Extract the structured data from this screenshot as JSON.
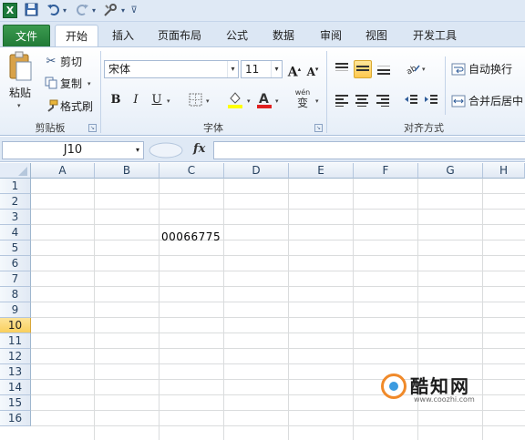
{
  "qat": {
    "save_icon": "save-icon",
    "undo_icon": "undo-icon",
    "redo_icon": "redo-icon",
    "tool_icon": "tools-icon",
    "customize_icon": "customize-icon",
    "logo_letter": "X"
  },
  "tabs": [
    {
      "label": "文件"
    },
    {
      "label": "开始"
    },
    {
      "label": "插入"
    },
    {
      "label": "页面布局"
    },
    {
      "label": "公式"
    },
    {
      "label": "数据"
    },
    {
      "label": "审阅"
    },
    {
      "label": "视图"
    },
    {
      "label": "开发工具"
    }
  ],
  "ribbon": {
    "clipboard": {
      "paste": "粘贴",
      "cut": "剪切",
      "copy": "复制",
      "format_painter": "格式刷",
      "label": "剪贴板"
    },
    "font": {
      "name": "宋体",
      "size": "11",
      "grow": "A",
      "shrink": "A",
      "bold": "B",
      "italic": "I",
      "underline": "U",
      "wen": "wén",
      "wen_char": "变",
      "label": "字体"
    },
    "alignment": {
      "wrap_text": "自动换行",
      "merge_center": "合并后居中",
      "label": "对齐方式"
    }
  },
  "formula_bar": {
    "name_box": "J10",
    "fx": "fx",
    "formula": ""
  },
  "sheet": {
    "columns": [
      "A",
      "B",
      "C",
      "D",
      "E",
      "F",
      "G",
      "H"
    ],
    "rows": [
      "1",
      "2",
      "3",
      "4",
      "5",
      "6",
      "7",
      "8",
      "9",
      "10",
      "11",
      "12",
      "13",
      "14",
      "15",
      "16"
    ],
    "selected_row": "10",
    "cells": {
      "C4": "00066775"
    }
  },
  "watermark": {
    "title": "酷知网",
    "subtitle": "www.coozhi.com"
  },
  "colors": {
    "file_tab": "#217a37",
    "highlight": "#ffc94e",
    "font_color_bar": "#e02020",
    "fill_color_bar": "#ffff00"
  }
}
